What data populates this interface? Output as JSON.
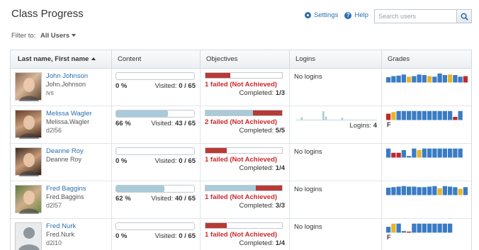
{
  "header": {
    "title": "Class Progress",
    "settings_label": "Settings",
    "help_label": "Help",
    "search_placeholder": "Search users"
  },
  "filter": {
    "label": "Filter to:",
    "value": "All Users"
  },
  "columns": {
    "name": "Last name, First name",
    "content": "Content",
    "objectives": "Objectives",
    "logins": "Logins",
    "grades": "Grades"
  },
  "colors": {
    "link": "#2a6fb0",
    "progress_fill": "#a9cad9",
    "failed_text": "#c8282c",
    "grade_blue": "#3a7cc4",
    "grade_yellow": "#e7b52a",
    "grade_red": "#c0272d"
  },
  "students": [
    {
      "name": "John Johnson",
      "login": "John.Johnson",
      "org_id": "ivs",
      "content": {
        "percent": "0 %",
        "visited_label": "Visited:",
        "visited_value": "0 / 65",
        "fraction": 0
      },
      "objectives": {
        "segments": [
          [
            "red",
            0.32
          ]
        ],
        "failed": "1 failed (Not Achieved)",
        "completed_label": "Completed:",
        "completed_value": "1/3"
      },
      "logins": {
        "text": "No logins"
      },
      "grades": {
        "bars": [
          "b",
          "b",
          "b",
          "b",
          "y",
          "b",
          "b",
          "b",
          "y",
          "b",
          "b",
          "b",
          "y",
          "b",
          "b",
          "r"
        ],
        "heights": [
          0.5,
          0.6,
          0.65,
          0.75,
          0.55,
          0.6,
          0.75,
          0.7,
          0.6,
          0.55,
          0.85,
          0.7,
          0.75,
          0.7,
          0.55,
          0.6
        ],
        "final": ""
      }
    },
    {
      "name": "Melissa Wagler",
      "login": "Melissa.Wagler",
      "org_id": "d2l56",
      "content": {
        "percent": "66 %",
        "visited_label": "Visited:",
        "visited_value": "43 / 65",
        "fraction": 0.66
      },
      "objectives": {
        "segments": [
          [
            "blue",
            0.62
          ],
          [
            "red",
            0.38
          ]
        ],
        "failed": "2 failed (Not Achieved)",
        "completed_label": "Completed:",
        "completed_value": "5/5"
      },
      "logins": {
        "text": "Logins:",
        "count": "4",
        "spark": [
          0,
          0,
          0.25,
          0,
          0,
          0,
          0,
          0,
          0,
          0,
          0.85,
          0.3,
          0,
          0,
          0,
          0,
          0,
          0.2,
          0,
          0,
          0,
          0,
          0,
          0,
          0,
          0,
          0,
          0,
          0,
          0
        ]
      },
      "grades": {
        "bars": [
          "r",
          "y",
          "b",
          "b",
          "b",
          "b",
          "b",
          "b",
          "b",
          "b",
          "b",
          "b",
          "b",
          "r",
          "b"
        ],
        "heights": [
          0.6,
          0.75,
          0.85,
          0.85,
          0.85,
          0.85,
          0.85,
          0.85,
          0.85,
          0.85,
          0.85,
          0.85,
          0.85,
          0.3,
          0.85
        ],
        "final": "F"
      }
    },
    {
      "name": "Deanne Roy",
      "login": "Deanne Roy",
      "org_id": "",
      "content": {
        "percent": "0 %",
        "visited_label": "Visited:",
        "visited_value": "0 / 65",
        "fraction": 0
      },
      "objectives": {
        "segments": [
          [
            "red",
            0.28
          ]
        ],
        "failed": "1 failed (Not Achieved)",
        "completed_label": "Completed:",
        "completed_value": "1/4"
      },
      "logins": {
        "text": "No logins"
      },
      "grades": {
        "bars": [
          "b",
          "r",
          "r",
          "b",
          "b",
          "b",
          "y",
          "b",
          "b",
          "b",
          "b",
          "b",
          "b",
          "b",
          "b"
        ],
        "heights": [
          0.85,
          0.45,
          0.45,
          0.7,
          0.15,
          0.85,
          0.7,
          0.85,
          0.85,
          0.85,
          0.85,
          0.85,
          0.85,
          0.85,
          0.85
        ],
        "final": ""
      }
    },
    {
      "name": "Fred Baggins",
      "login": "Fred.Baggins",
      "org_id": "d2l57",
      "content": {
        "percent": "62 %",
        "visited_label": "Visited:",
        "visited_value": "40 / 65",
        "fraction": 0.62
      },
      "objectives": {
        "segments": [
          [
            "blue",
            0.66
          ],
          [
            "red",
            0.34
          ]
        ],
        "failed": "1 failed (Not Achieved)",
        "completed_label": "Completed:",
        "completed_value": "3/3"
      },
      "logins": {
        "text": "No logins"
      },
      "grades": {
        "bars": [
          "b",
          "b",
          "b",
          "b",
          "b",
          "b",
          "b",
          "b",
          "b",
          "b",
          "y",
          "b",
          "b",
          "b",
          "y",
          "b"
        ],
        "heights": [
          0.7,
          0.75,
          0.8,
          0.85,
          0.8,
          0.8,
          0.75,
          0.75,
          0.8,
          0.85,
          0.65,
          0.85,
          0.8,
          0.75,
          0.6,
          0.75
        ],
        "final": ""
      }
    },
    {
      "name": "Fred Nurk",
      "login": "Fred.Nurk",
      "org_id": "d2l10",
      "content": {
        "percent": "0 %",
        "visited_label": "Visited:",
        "visited_value": "0 / 65",
        "fraction": 0
      },
      "objectives": {
        "segments": [
          [
            "red",
            0.28
          ]
        ],
        "failed": "1 failed (Not Achieved)",
        "completed_label": "Completed:",
        "completed_value": "1/4"
      },
      "logins": {
        "text": "No logins"
      },
      "grades": {
        "bars": [
          "b",
          "y",
          "b",
          "b",
          "r",
          "b",
          "b",
          "b",
          "b",
          "b",
          "b",
          "b",
          "b"
        ],
        "heights": [
          0.55,
          0.85,
          0.85,
          0.15,
          0.1,
          0.85,
          0.85,
          0.85,
          0.85,
          0.85,
          0.85,
          0.85,
          0.85
        ],
        "final": "F"
      }
    }
  ]
}
